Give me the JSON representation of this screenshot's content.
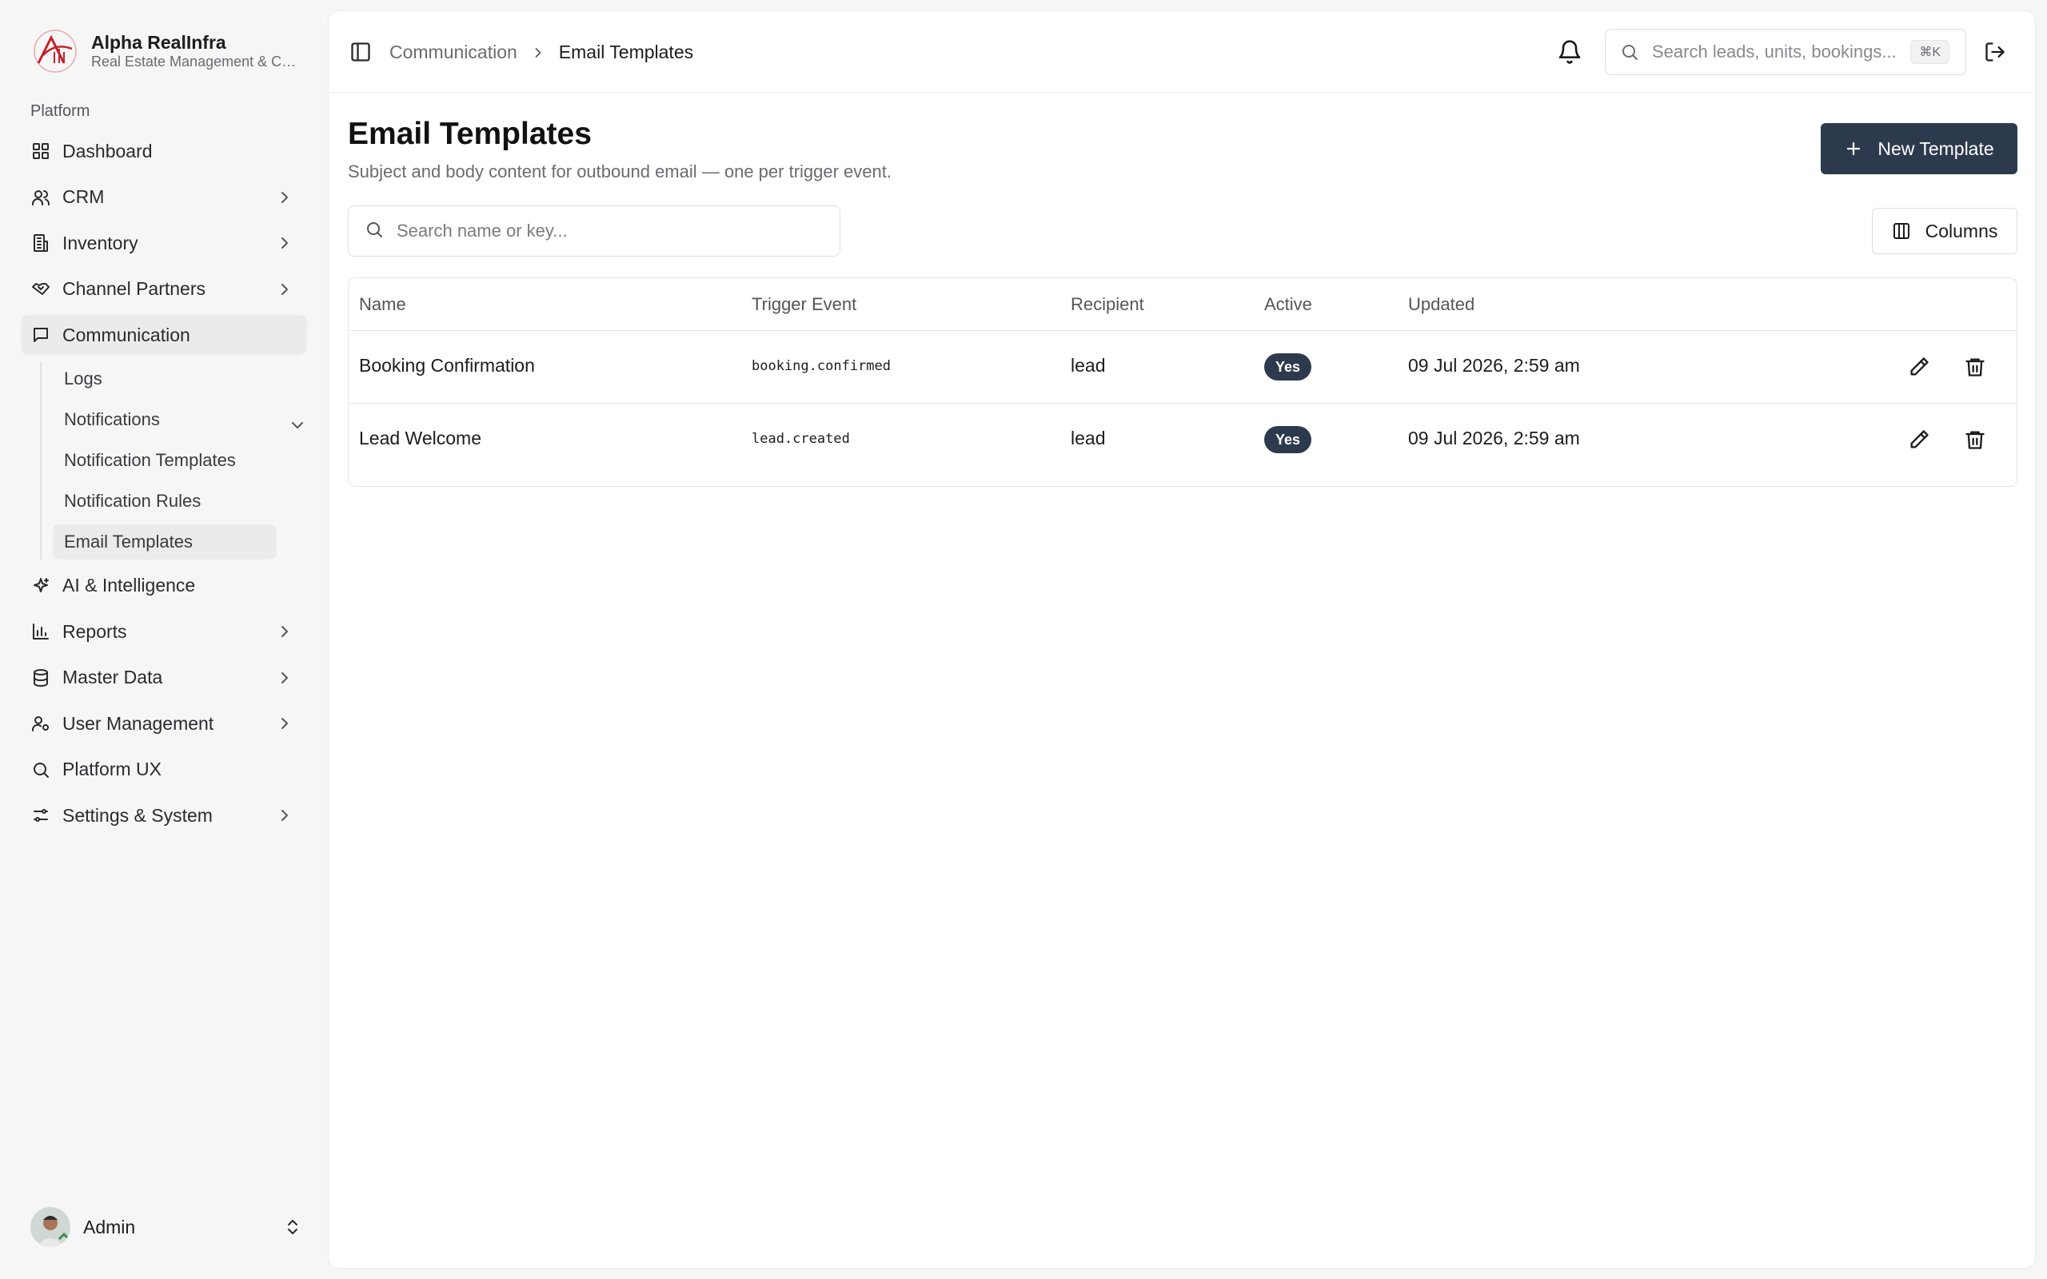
{
  "brand": {
    "name": "Alpha RealInfra",
    "subtitle": "Real Estate Management & CRM"
  },
  "sidebar": {
    "section_label": "Platform",
    "items": [
      {
        "label": "Dashboard",
        "icon": "grid-icon"
      },
      {
        "label": "CRM",
        "icon": "users-icon"
      },
      {
        "label": "Inventory",
        "icon": "building-icon"
      },
      {
        "label": "Channel Partners",
        "icon": "handshake-icon"
      },
      {
        "label": "Communication",
        "icon": "message-icon"
      },
      {
        "label": "AI & Intelligence",
        "icon": "sparkles-icon"
      },
      {
        "label": "Reports",
        "icon": "bar-chart-icon"
      },
      {
        "label": "Master Data",
        "icon": "database-icon"
      },
      {
        "label": "User Management",
        "icon": "user-cog-icon"
      },
      {
        "label": "Platform UX",
        "icon": "search-icon"
      },
      {
        "label": "Settings & System",
        "icon": "sliders-icon"
      }
    ],
    "communication_sub": [
      {
        "label": "Logs"
      },
      {
        "label": "Notifications"
      },
      {
        "label": "Notification Templates"
      },
      {
        "label": "Notification Rules"
      },
      {
        "label": "Email Templates"
      }
    ],
    "user": {
      "name": "Admin"
    }
  },
  "topbar": {
    "breadcrumb_parent": "Communication",
    "breadcrumb_current": "Email Templates",
    "search_placeholder": "Search leads, units, bookings...",
    "search_shortcut": "⌘K"
  },
  "page": {
    "title": "Email Templates",
    "subtitle": "Subject and body content for outbound email — one per trigger event.",
    "new_button": "New Template",
    "columns_button": "Columns",
    "search_placeholder": "Search name or key..."
  },
  "table": {
    "headers": [
      "Name",
      "Trigger Event",
      "Recipient",
      "Active",
      "Updated"
    ],
    "rows": [
      {
        "name": "Booking Confirmation",
        "trigger": "booking.confirmed",
        "recipient": "lead",
        "active": "Yes",
        "updated": "09 Jul 2026, 2:59 am"
      },
      {
        "name": "Lead Welcome",
        "trigger": "lead.created",
        "recipient": "lead",
        "active": "Yes",
        "updated": "09 Jul 2026, 2:59 am"
      }
    ]
  },
  "colors": {
    "primary": "#2d3a4e",
    "brand_red": "#c8202a"
  }
}
